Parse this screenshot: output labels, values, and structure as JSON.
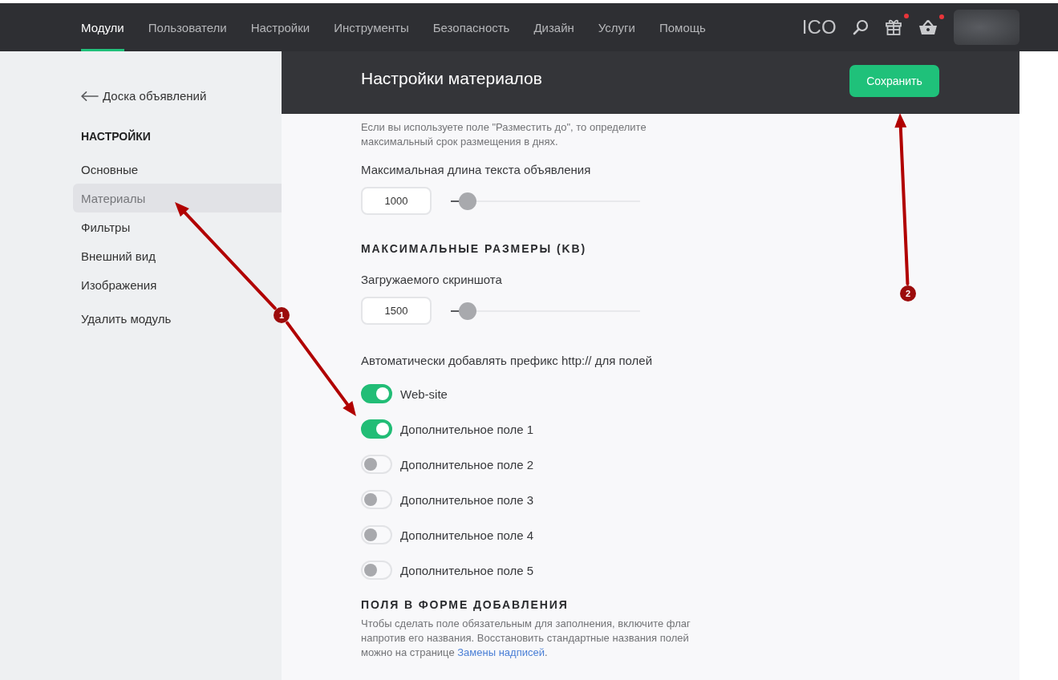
{
  "nav": {
    "tabs": [
      {
        "label": "Модули",
        "selected": true
      },
      {
        "label": "Пользователи",
        "selected": false
      },
      {
        "label": "Настройки",
        "selected": false
      },
      {
        "label": "Инструменты",
        "selected": false
      },
      {
        "label": "Безопасность",
        "selected": false
      },
      {
        "label": "Дизайн",
        "selected": false
      },
      {
        "label": "Услуги",
        "selected": false
      },
      {
        "label": "Помощь",
        "selected": false
      }
    ],
    "brand": "ICO",
    "icons": [
      {
        "kind": "search",
        "unread": false
      },
      {
        "kind": "gift",
        "unread": true
      },
      {
        "kind": "basket",
        "unread": true
      }
    ]
  },
  "sidebar": {
    "back_link": "Доска объявлений",
    "heading": "НАСТРОЙКИ",
    "items": [
      {
        "label": "Основные",
        "selected": false
      },
      {
        "label": "Материалы",
        "selected": true
      },
      {
        "label": "Фильтры",
        "selected": false
      },
      {
        "label": "Внешний вид",
        "selected": false
      },
      {
        "label": "Изображения",
        "selected": false
      }
    ],
    "delete_link": "Удалить модуль"
  },
  "panel": {
    "title": "Настройки материалов",
    "save_button": "Сохранить",
    "blocks": [
      {
        "kind": "note",
        "text": "Если вы используете поле \"Разместить до\", то определите максимальный срок размещения в днях."
      },
      {
        "kind": "label",
        "text": "Максимальная длина текста объявления"
      },
      {
        "kind": "slider",
        "value": "1000",
        "level": 0.09
      },
      {
        "kind": "heading",
        "text": "МАКСИМАЛЬНЫЕ РАЗМЕРЫ (KB)"
      },
      {
        "kind": "label",
        "text": "Загружаемого скриншота"
      },
      {
        "kind": "slider",
        "value": "1500",
        "level": 0.09
      },
      {
        "kind": "label",
        "text": "Автоматически добавлять префикс http:// для полей"
      },
      {
        "kind": "toggle",
        "label": "Web-site",
        "on": true
      },
      {
        "kind": "toggle",
        "label": "Дополнительное поле 1",
        "on": true
      },
      {
        "kind": "toggle",
        "label": "Дополнительное поле 2",
        "on": false
      },
      {
        "kind": "toggle",
        "label": "Дополнительное поле 3",
        "on": false
      },
      {
        "kind": "toggle",
        "label": "Дополнительное поле 4",
        "on": false
      },
      {
        "kind": "toggle",
        "label": "Дополнительное поле 5",
        "on": false
      },
      {
        "kind": "heading",
        "text": "ПОЛЯ В ФОРМЕ ДОБАВЛЕНИЯ"
      },
      {
        "kind": "note_link",
        "before": "Чтобы сделать поле обязательным для заполнения, включите флаг напротив его названия. Восстановить стандартные названия полей можно на странице ",
        "link": "Замены надписей",
        "after": "."
      }
    ]
  },
  "annotations": [
    {
      "number": "1"
    },
    {
      "number": "2"
    }
  ]
}
